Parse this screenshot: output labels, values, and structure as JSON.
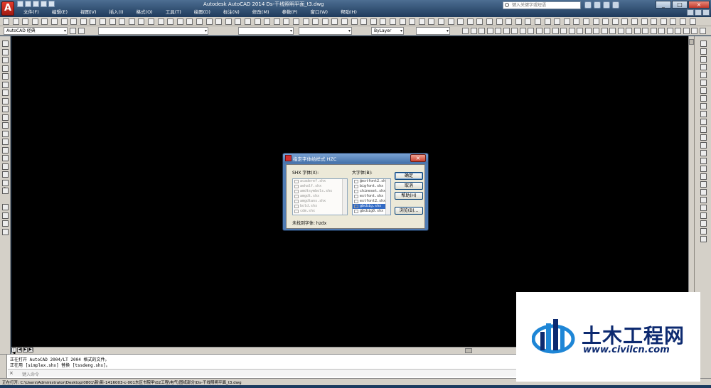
{
  "window": {
    "title": "Autodesk AutoCAD 2014    Ds-干线照明平面_t3.dwg",
    "search_placeholder": "键入关键字或短语",
    "min": "_",
    "max": "□",
    "close": "×"
  },
  "menu": [
    "文件(F)",
    "编辑(E)",
    "视图(V)",
    "插入(I)",
    "格式(O)",
    "工具(T)",
    "绘图(D)",
    "标注(N)",
    "修改(M)",
    "参数(P)",
    "窗口(W)",
    "帮助(H)"
  ],
  "toolbar": {
    "workspace": "AutoCAD 经典",
    "linetype": "ByLayer"
  },
  "dialog": {
    "title": "指定字体给样式 HZC",
    "close": "×",
    "shx_label": "SHX 字体(X):",
    "big_label": "大字体(B):",
    "shx_fonts": [
      "acaderef.shx",
      "aehalf.shx",
      "amdtsymbols.shx",
      "amgdt.shx",
      "amgdtans.shx",
      "bold.shx",
      "cdm.shx"
    ],
    "big_fonts": [
      "@extfont2.shx",
      "bigfont.shx",
      "chineset.shx",
      "extfont.shx",
      "extfont2.shx",
      "gbcbig.shx",
      "gbcbig0.shx"
    ],
    "selected_big": "gbcbig.shx",
    "missing_label": "未找到字体: hzdx",
    "buttons": {
      "ok": "确定",
      "cancel": "取消",
      "help": "帮助(H)",
      "browse": "浏览(B)..."
    }
  },
  "command": {
    "line1": "正在打开 AutoCAD 2004/LT 2004 格式的文件。",
    "line2": "正在用 [simplex.shx] 替换 [tssdeng.shx]。",
    "input_placeholder": "键入命令",
    "close_icon": "×"
  },
  "status": {
    "text": "正在打开: C:\\Users\\Administrator\\Desktop\\0801\\新\\新-1416003-c-001东区书院甲\\02工程\\电气\\图纸部分\\Ds-干线照明平面_t3.dwg"
  },
  "watermark": {
    "name_cn": "土木工程网",
    "url": "www.civilcn.com"
  },
  "colors": {
    "canvas": "#000000",
    "selection": "#316ac5",
    "title_gradient_top": "#4d6e92",
    "watermark_blue": "#0d2a70"
  }
}
